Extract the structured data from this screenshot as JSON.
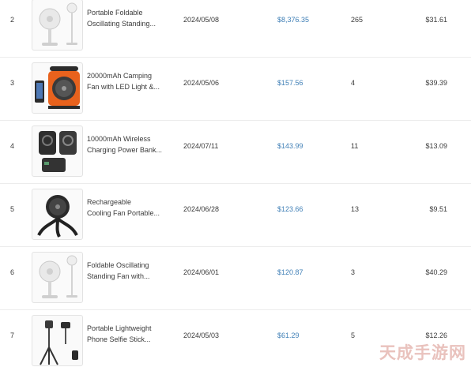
{
  "rows": [
    {
      "rank": "2",
      "name_line1": "Portable Foldable",
      "name_line2": "Oscillating Standing...",
      "date": "2024/05/08",
      "revenue": "$8,376.35",
      "sales": "265",
      "price": "$31.61",
      "image_icon": "standing-fan-icon"
    },
    {
      "rank": "3",
      "name_line1": "20000mAh Camping",
      "name_line2": "Fan with LED Light &...",
      "date": "2024/05/06",
      "revenue": "$157.56",
      "sales": "4",
      "price": "$39.39",
      "image_icon": "camping-fan-icon"
    },
    {
      "rank": "4",
      "name_line1": "10000mAh Wireless",
      "name_line2": "Charging Power Bank...",
      "date": "2024/07/11",
      "revenue": "$143.99",
      "sales": "11",
      "price": "$13.09",
      "image_icon": "power-bank-icon"
    },
    {
      "rank": "5",
      "name_line1": "Rechargeable",
      "name_line2": "Cooling Fan Portable...",
      "date": "2024/06/28",
      "revenue": "$123.66",
      "sales": "13",
      "price": "$9.51",
      "image_icon": "tripod-fan-icon"
    },
    {
      "rank": "6",
      "name_line1": "Foldable Oscillating",
      "name_line2": "Standing Fan with...",
      "date": "2024/06/01",
      "revenue": "$120.87",
      "sales": "3",
      "price": "$40.29",
      "image_icon": "standing-fan-icon"
    },
    {
      "rank": "7",
      "name_line1": "Portable Lightweight",
      "name_line2": "Phone Selfie Stick...",
      "date": "2024/05/03",
      "revenue": "$61.29",
      "sales": "5",
      "price": "$12.26",
      "image_icon": "selfie-stick-icon"
    }
  ],
  "watermark": "天成手游网",
  "colors": {
    "revenue": "#3f7fb6",
    "text": "#3b3b3b",
    "divider": "#ececec",
    "watermark": "#e6b8b2"
  }
}
